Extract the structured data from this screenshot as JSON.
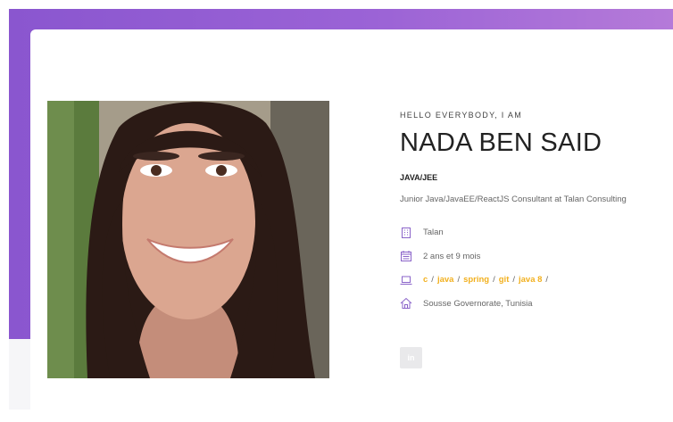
{
  "profile": {
    "greeting": "HELLO EVERYBODY, I AM",
    "name": "NADA BEN SAID",
    "role": "JAVA/JEE",
    "summary": "Junior Java/JavaEE/ReactJS Consultant at Talan Consulting"
  },
  "details": {
    "company": "Talan",
    "experience": "2 ans et 9 mois",
    "skills": [
      "c",
      "java",
      "spring",
      "git",
      "java 8"
    ],
    "skill_separator": "/",
    "location": "Sousse Governorate, Tunisia"
  },
  "social": {
    "linkedin_label": "in"
  },
  "icons": {
    "company": "building-icon",
    "experience": "calendar-icon",
    "skills": "laptop-icon",
    "location": "home-icon"
  },
  "colors": {
    "gradient_start": "#8a56cf",
    "gradient_end": "#b57ad9",
    "skill_accent": "#f2b01e",
    "icon_accent": "#8a63c9"
  }
}
